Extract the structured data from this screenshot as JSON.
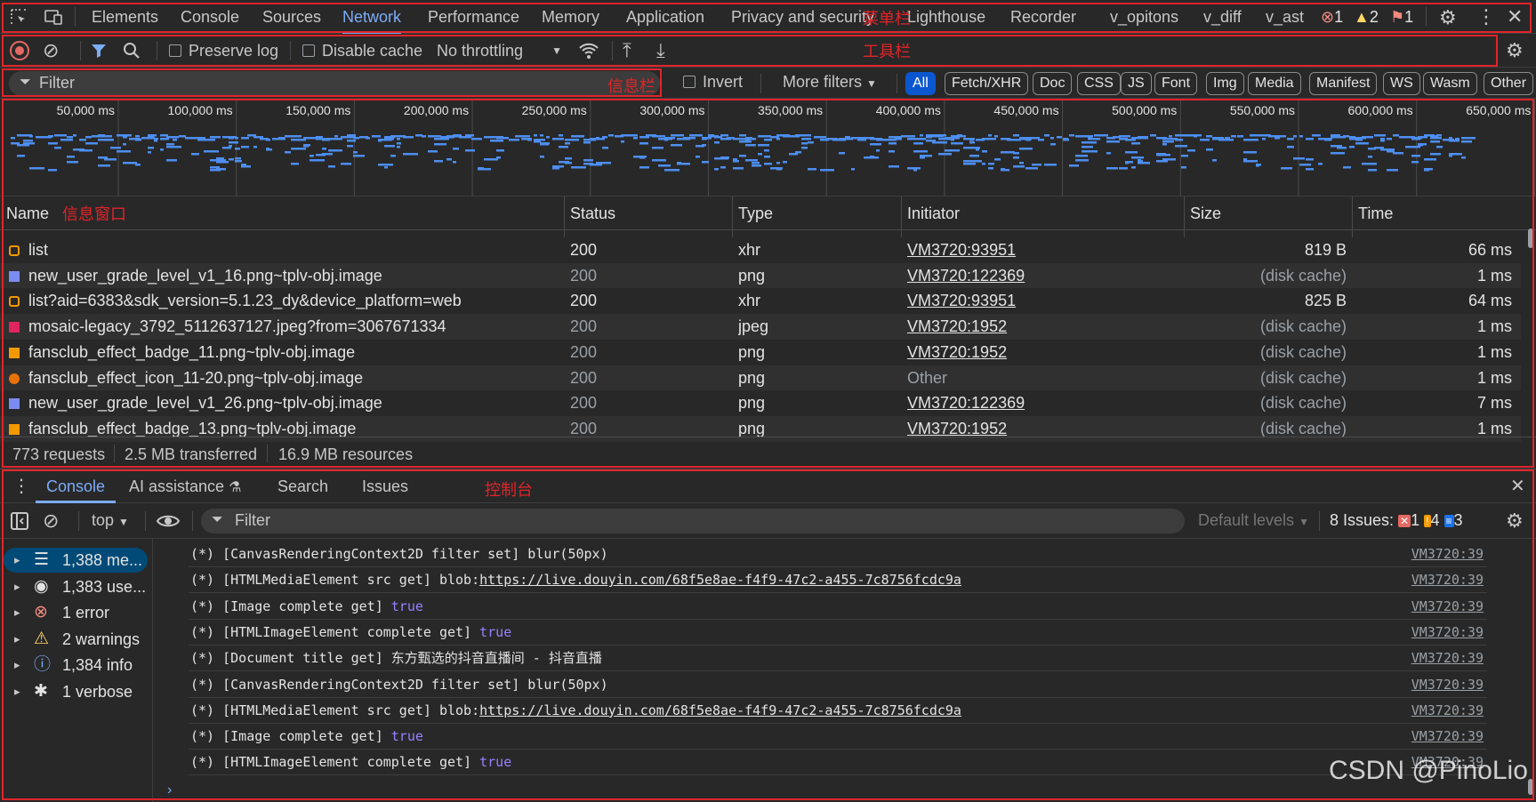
{
  "menubar": {
    "tabs": [
      "Elements",
      "Console",
      "Sources",
      "Network",
      "Performance",
      "Memory",
      "Application",
      "Privacy and security",
      "Lighthouse",
      "Recorder",
      "v_opitons",
      "v_diff",
      "v_ast"
    ],
    "active": "Network",
    "errors": "1",
    "warnings": "2",
    "issues": "1"
  },
  "toolbar": {
    "preserve_log": "Preserve log",
    "disable_cache": "Disable cache",
    "throttling": "No throttling"
  },
  "filterbar": {
    "placeholder": "Filter",
    "invert": "Invert",
    "more_filters": "More filters",
    "types": [
      "All",
      "Fetch/XHR",
      "Doc",
      "CSS",
      "JS",
      "Font",
      "Img",
      "Media",
      "Manifest",
      "WS",
      "Wasm",
      "Other"
    ]
  },
  "overview": {
    "ticks": [
      "50,000 ms",
      "100,000 ms",
      "150,000 ms",
      "200,000 ms",
      "250,000 ms",
      "300,000 ms",
      "350,000 ms",
      "400,000 ms",
      "450,000 ms",
      "500,000 ms",
      "550,000 ms",
      "600,000 ms",
      "650,000 ms"
    ]
  },
  "table": {
    "headers": [
      "Name",
      "Status",
      "Type",
      "Initiator",
      "Size",
      "Time"
    ],
    "rows": [
      {
        "icon": "xhr-icon",
        "name": "list",
        "status": "200",
        "type": "xhr",
        "initiator": "VM3720:93951",
        "size": "819 B",
        "time": "66 ms",
        "cached": false
      },
      {
        "icon": "image-icon",
        "name": "new_user_grade_level_v1_16.png~tplv-obj.image",
        "status": "200",
        "type": "png",
        "initiator": "VM3720:122369",
        "size": "(disk cache)",
        "time": "1 ms",
        "cached": true
      },
      {
        "icon": "xhr-icon",
        "name": "list?aid=6383&sdk_version=5.1.23_dy&device_platform=web",
        "status": "200",
        "type": "xhr",
        "initiator": "VM3720:93951",
        "size": "825 B",
        "time": "64 ms",
        "cached": false
      },
      {
        "icon": "image-icon",
        "name": "mosaic-legacy_3792_5112637127.jpeg?from=3067671334",
        "status": "200",
        "type": "jpeg",
        "initiator": "VM3720:1952",
        "size": "(disk cache)",
        "time": "1 ms",
        "cached": true
      },
      {
        "icon": "image-icon",
        "name": "fansclub_effect_badge_11.png~tplv-obj.image",
        "status": "200",
        "type": "png",
        "initiator": "VM3720:1952",
        "size": "(disk cache)",
        "time": "1 ms",
        "cached": true
      },
      {
        "icon": "image-icon",
        "name": "fansclub_effect_icon_11-20.png~tplv-obj.image",
        "status": "200",
        "type": "png",
        "initiator": "Other",
        "size": "(disk cache)",
        "time": "1 ms",
        "cached": true
      },
      {
        "icon": "image-icon",
        "name": "new_user_grade_level_v1_26.png~tplv-obj.image",
        "status": "200",
        "type": "png",
        "initiator": "VM3720:122369",
        "size": "(disk cache)",
        "time": "7 ms",
        "cached": true
      },
      {
        "icon": "image-icon",
        "name": "fansclub_effect_badge_13.png~tplv-obj.image",
        "status": "200",
        "type": "png",
        "initiator": "VM3720:1952",
        "size": "(disk cache)",
        "time": "1 ms",
        "cached": true
      }
    ]
  },
  "summary": {
    "requests": "773 requests",
    "transferred": "2.5 MB transferred",
    "resources": "16.9 MB resources"
  },
  "drawer": {
    "tabs": [
      "Console",
      "AI assistance",
      "Search",
      "Issues"
    ],
    "active": "Console",
    "context": "top",
    "filter_placeholder": "Filter",
    "levels": "Default levels",
    "issues_label": "8 Issues:",
    "issues_error": "1",
    "issues_warning": "4",
    "issues_info": "3"
  },
  "sidebar": [
    {
      "icon": "list-icon",
      "label": "1,388 me...",
      "selected": true
    },
    {
      "icon": "user-icon",
      "label": "1,383 use...",
      "selected": false
    },
    {
      "icon": "error-icon",
      "label": "1 error",
      "selected": false
    },
    {
      "icon": "warning-icon",
      "label": "2 warnings",
      "selected": false
    },
    {
      "icon": "info-icon",
      "label": "1,384 info",
      "selected": false
    },
    {
      "icon": "bug-icon",
      "label": "1 verbose",
      "selected": false
    }
  ],
  "console": {
    "messages": [
      {
        "text": "(*) [CanvasRenderingContext2D filter set] blur(50px)",
        "link": "",
        "value": "",
        "src": "VM3720:39"
      },
      {
        "text": "(*) [HTMLMediaElement src get] blob:",
        "link": "https://live.douyin.com/68f5e8ae-f4f9-47c2-a455-7c8756fcdc9a",
        "value": "",
        "src": "VM3720:39"
      },
      {
        "text": "(*) [Image complete get] ",
        "link": "",
        "value": "true",
        "src": "VM3720:39"
      },
      {
        "text": "(*) [HTMLImageElement complete get] ",
        "link": "",
        "value": "true",
        "src": "VM3720:39"
      },
      {
        "text": "(*) [Document title get] 东方甄选的抖音直播间 - 抖音直播",
        "link": "",
        "value": "",
        "src": "VM3720:39"
      },
      {
        "text": "(*) [CanvasRenderingContext2D filter set] blur(50px)",
        "link": "",
        "value": "",
        "src": "VM3720:39"
      },
      {
        "text": "(*) [HTMLMediaElement src get] blob:",
        "link": "https://live.douyin.com/68f5e8ae-f4f9-47c2-a455-7c8756fcdc9a",
        "value": "",
        "src": "VM3720:39"
      },
      {
        "text": "(*) [Image complete get] ",
        "link": "",
        "value": "true",
        "src": "VM3720:39"
      },
      {
        "text": "(*) [HTMLImageElement complete get] ",
        "link": "",
        "value": "true",
        "src": "VM3720:39"
      }
    ]
  },
  "annotations": {
    "menubar": "菜单栏",
    "toolbar": "工具栏",
    "infobar": "信息栏",
    "infowindow": "信息窗口",
    "console": "控制台"
  },
  "watermark": "CSDN @PinoLio",
  "colors": {
    "accent": "#7cacf8",
    "annotation": "#e0242a",
    "record": "#e46962",
    "selected_bg": "#004a77"
  }
}
